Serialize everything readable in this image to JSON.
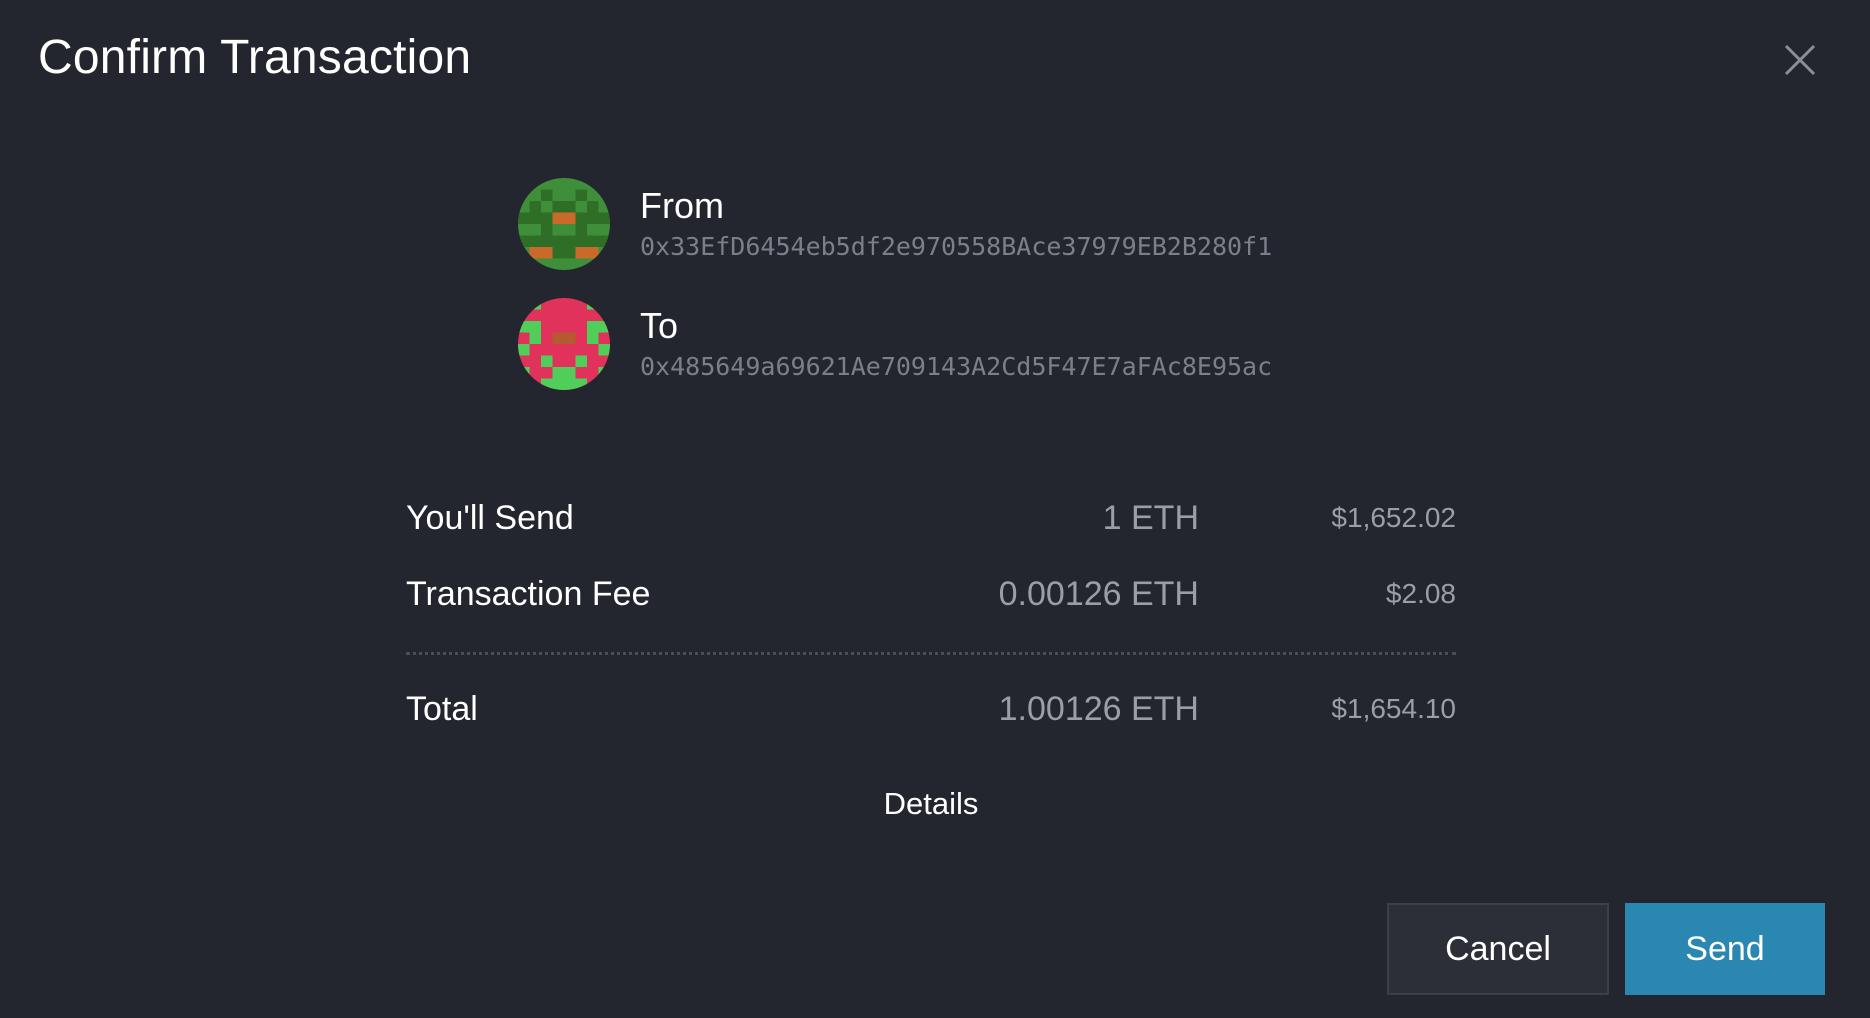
{
  "dialog": {
    "title": "Confirm Transaction",
    "close_icon": "close-icon"
  },
  "from": {
    "label": "From",
    "address": "0x33EfD6454eb5df2e970558BAce37979EB2B280f1",
    "identicon_colors": [
      "#3f8f3a",
      "#2e6e27",
      "#c96a2a"
    ]
  },
  "to": {
    "label": "To",
    "address": "0x485649a69621Ae709143A2Cd5F47E7aFAc8E95ac",
    "identicon_colors": [
      "#e0325a",
      "#4fcf5a",
      "#b25a30"
    ]
  },
  "summary": {
    "rows": [
      {
        "label": "You'll Send",
        "eth": "1 ETH",
        "usd": "$1,652.02"
      },
      {
        "label": "Transaction Fee",
        "eth": "0.00126 ETH",
        "usd": "$2.08"
      }
    ],
    "total": {
      "label": "Total",
      "eth": "1.00126 ETH",
      "usd": "$1,654.10"
    }
  },
  "details_label": "Details",
  "buttons": {
    "cancel_label": "Cancel",
    "send_label": "Send"
  },
  "colors": {
    "background": "#23262e",
    "accent": "#2a87b1"
  }
}
